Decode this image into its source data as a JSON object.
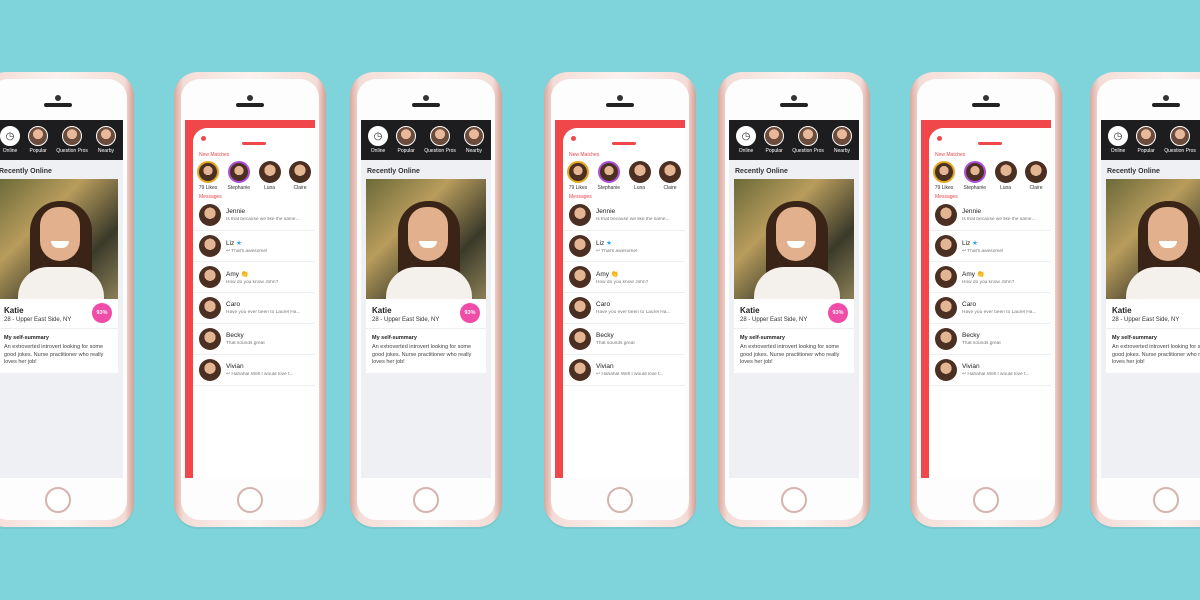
{
  "tabs": [
    {
      "label": "Online"
    },
    {
      "label": "Popular"
    },
    {
      "label": "Question Pros"
    },
    {
      "label": "Nearby"
    }
  ],
  "recently_online": "Recently Online",
  "profile": {
    "name": "Katie",
    "location": "28 - Upper East Side, NY",
    "match": "93%",
    "summary_title": "My self-summary",
    "summary_text": "An extroverted introvert looking for some good jokes. Nurse practitioner who really loves her job!"
  },
  "messages_screen": {
    "new_matches_label": "New Matches",
    "messages_label": "Messages",
    "matches": [
      {
        "label": "79 Likes"
      },
      {
        "label": "Stephanie"
      },
      {
        "label": "Luna"
      },
      {
        "label": "Claire"
      }
    ],
    "messages": [
      {
        "name": "Jennie",
        "preview": "Is that because we like the same..."
      },
      {
        "name": "Liz",
        "preview": "↩ That's awesome!"
      },
      {
        "name": "Amy",
        "preview": "How do you know John?"
      },
      {
        "name": "Caro",
        "preview": "Have you ever been to Laurel Ha..."
      },
      {
        "name": "Becky",
        "preview": "That sounds great"
      },
      {
        "name": "Vivian",
        "preview": "↩ Hahaha! Well I would love t..."
      }
    ]
  }
}
